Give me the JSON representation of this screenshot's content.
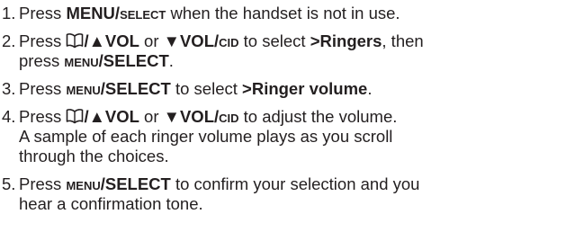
{
  "steps": [
    {
      "number": "1.",
      "lines": [
        [
          {
            "t": "Press "
          },
          {
            "t": "MENU/",
            "b": true
          },
          {
            "t": "select",
            "sc": true
          },
          {
            "t": " when the handset is not in use."
          }
        ]
      ]
    },
    {
      "number": "2.",
      "lines": [
        [
          {
            "t": "Press "
          },
          {
            "icon": "phonebook-icon"
          },
          {
            "t": "/▲VOL",
            "b": true
          },
          {
            "t": " or "
          },
          {
            "t": "▼VOL/",
            "b": true
          },
          {
            "t": "cid",
            "sc": true
          },
          {
            "t": " to select "
          },
          {
            "t": ">Ringers",
            "b": true
          },
          {
            "t": ", then"
          }
        ],
        [
          {
            "t": "press "
          },
          {
            "t": "menu",
            "sc": true
          },
          {
            "t": "/SELECT",
            "b": true
          },
          {
            "t": "."
          }
        ]
      ]
    },
    {
      "number": "3.",
      "lines": [
        [
          {
            "t": "Press "
          },
          {
            "t": "menu",
            "sc": true
          },
          {
            "t": "/SELECT",
            "b": true
          },
          {
            "t": " to select "
          },
          {
            "t": ">Ringer volume",
            "b": true
          },
          {
            "t": "."
          }
        ]
      ]
    },
    {
      "number": "4.",
      "lines": [
        [
          {
            "t": "Press "
          },
          {
            "icon": "phonebook-icon"
          },
          {
            "t": "/▲VOL",
            "b": true
          },
          {
            "t": " or "
          },
          {
            "t": "▼VOL/",
            "b": true
          },
          {
            "t": "cid",
            "sc": true
          },
          {
            "t": " to adjust the volume."
          }
        ],
        [
          {
            "t": "A sample of each ringer volume plays as you scroll"
          }
        ],
        [
          {
            "t": "through the choices."
          }
        ]
      ]
    },
    {
      "number": "5.",
      "lines": [
        [
          {
            "t": "Press "
          },
          {
            "t": "menu",
            "sc": true
          },
          {
            "t": "/SELECT",
            "b": true
          },
          {
            "t": " to confirm your selection and you"
          }
        ],
        [
          {
            "t": "hear a confirmation tone."
          }
        ]
      ]
    }
  ]
}
